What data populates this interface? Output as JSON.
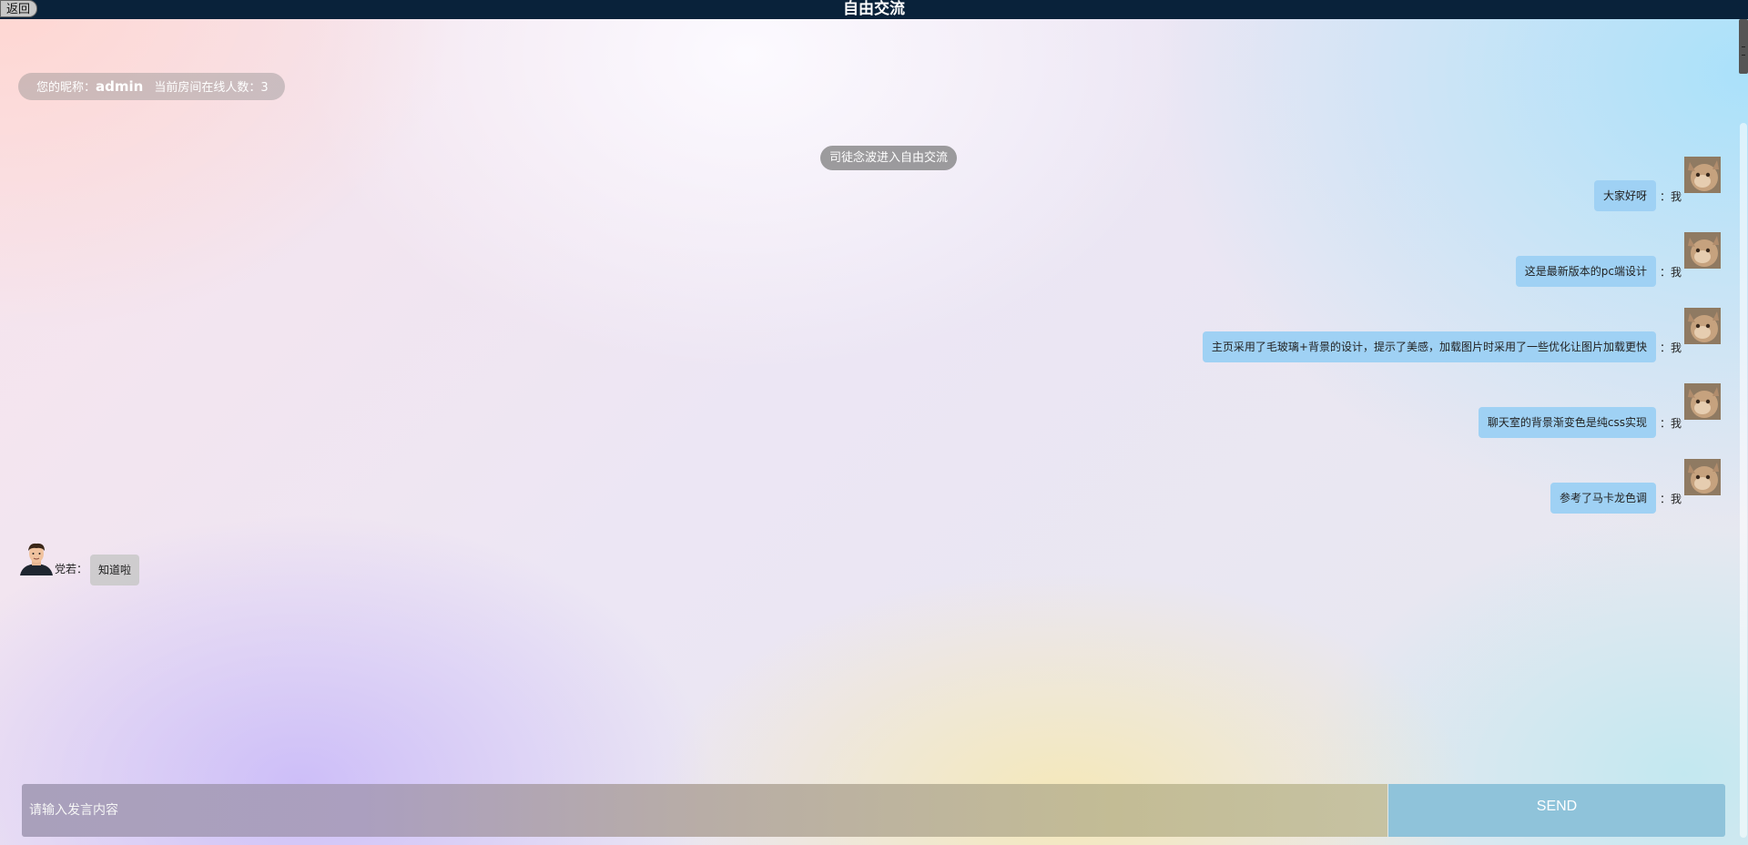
{
  "header": {
    "back_label": "返回",
    "title": "自由交流"
  },
  "room_info": {
    "nickname_label": "您的昵称：",
    "nickname": "admin",
    "online_label": "当前房间在线人数：",
    "online_count": "3"
  },
  "system_notice": "司徒念波进入自由交流",
  "messages_self": [
    {
      "text": "大家好呀",
      "sender": "：我"
    },
    {
      "text": "这是最新版本的pc端设计",
      "sender": "：我"
    },
    {
      "text": "主页采用了毛玻璃+背景的设计，提示了美感，加载图片时采用了一些优化让图片加载更快",
      "sender": "：我"
    },
    {
      "text": "聊天室的背景渐变色是纯css实现",
      "sender": "：我"
    },
    {
      "text": "参考了马卡龙色调",
      "sender": "：我"
    }
  ],
  "message_other": {
    "sender": "党若：",
    "text": "知道啦"
  },
  "composer": {
    "placeholder": "请输入发言内容",
    "send_label": "SEND"
  },
  "colors": {
    "topbar": "#09223a",
    "self_bubble": "#9fd1f4",
    "send_button": "#8fc3da"
  }
}
